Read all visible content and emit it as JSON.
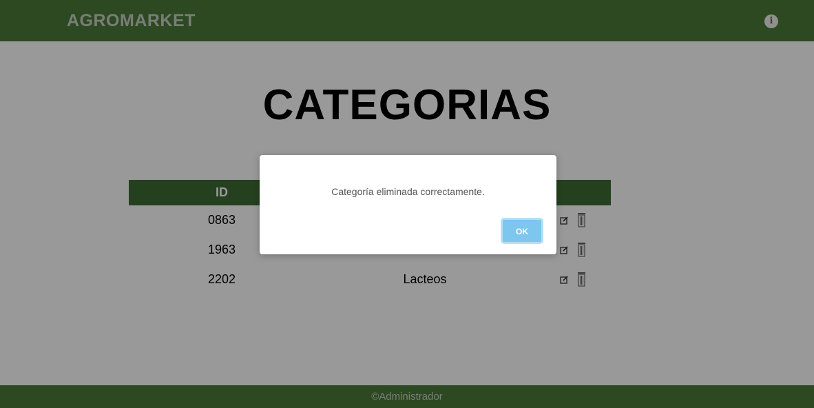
{
  "header": {
    "brand": "AGROMARKET",
    "info_icon": "info-icon",
    "info_glyph": "i"
  },
  "page": {
    "title": "CATEGORIAS"
  },
  "table": {
    "headers": {
      "id": "ID",
      "name": "",
      "actions": ""
    },
    "rows": [
      {
        "id": "0863",
        "name": ""
      },
      {
        "id": "1963",
        "name": ""
      },
      {
        "id": "2202",
        "name": "Lacteos"
      }
    ]
  },
  "footer": {
    "text": "©Administrador"
  },
  "dialog": {
    "message": "Categoría eliminada correctamente.",
    "ok_label": "OK"
  },
  "colors": {
    "header_green": "#4a7a3a",
    "table_header_green": "#3f6b33",
    "ok_button": "#7cc6ef",
    "overlay": "rgba(0,0,0,0.4)"
  }
}
